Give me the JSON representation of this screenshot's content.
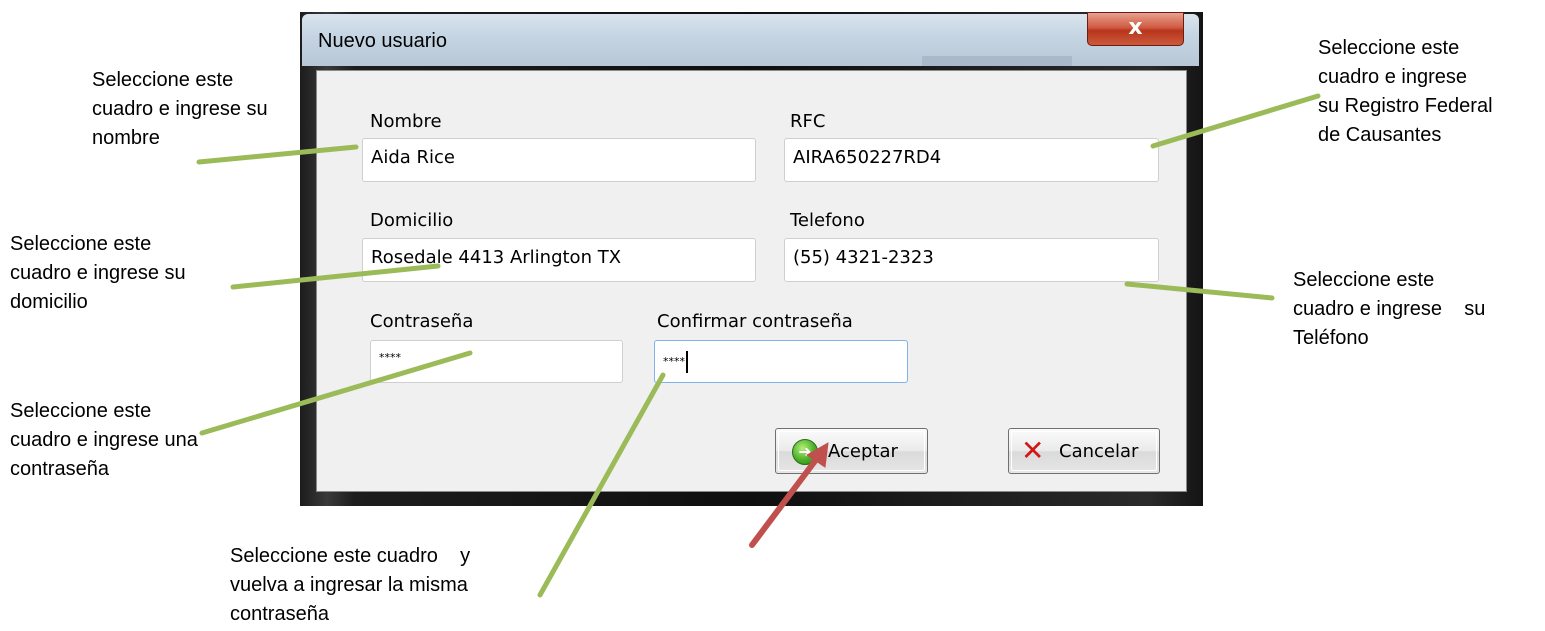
{
  "dialog": {
    "title": "Nuevo usuario",
    "close_glyph": "x",
    "fields": {
      "nombre": {
        "label": "Nombre",
        "value": "Aida Rice"
      },
      "rfc": {
        "label": "RFC",
        "value": "AIRA650227RD4"
      },
      "domicilio": {
        "label": "Domicilio",
        "value": "Rosedale 4413  Arlington TX"
      },
      "telefono": {
        "label": "Telefono",
        "value": "(55) 4321-2323"
      },
      "contrasena": {
        "label": "Contraseña",
        "value": "****"
      },
      "confirmar": {
        "label": "Confirmar contraseña",
        "value": "****"
      }
    },
    "buttons": {
      "aceptar": "Aceptar",
      "cancelar": "Cancelar"
    }
  },
  "annotations": {
    "nombre": "Seleccione este\ncuadro e ingrese su\nnombre",
    "domicilio": "Seleccione este\ncuadro e ingrese su\ndomicilio",
    "contrasena": "Seleccione este\ncuadro e ingrese una\ncontraseña",
    "confirmar": "Seleccione este cuadro    y\nvuelva a ingresar la misma\ncontraseña",
    "rfc": "Seleccione este\ncuadro e ingrese\nsu Registro Federal\nde Causantes",
    "telefono": "Seleccione este\ncuadro e ingrese    su\nTeléfono"
  },
  "colors": {
    "pointer_line": "#9bbb59",
    "pointer_arrow": "#c0504d"
  }
}
